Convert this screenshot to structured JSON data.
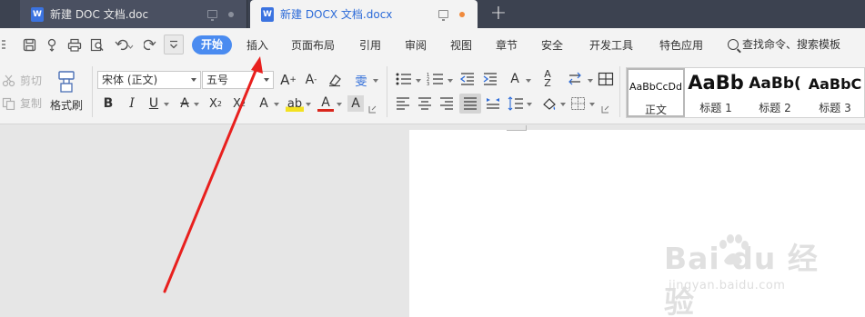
{
  "tabs": [
    {
      "icon": "W",
      "title": "新建 DOC 文档.doc",
      "active": false
    },
    {
      "icon": "W",
      "title": "新建 DOCX 文档.docx",
      "active": true
    }
  ],
  "new_tab_label": "+",
  "menu": {
    "start": "开始",
    "items": [
      "插入",
      "页面布局",
      "引用",
      "审阅",
      "视图",
      "章节",
      "安全",
      "开发工具",
      "特色应用"
    ],
    "search": "查找命令、搜索模板"
  },
  "ribbon": {
    "cut": "剪切",
    "copy": "复制",
    "format_painter": "格式刷",
    "font_name": "宋体 (正文)",
    "font_size": "五号"
  },
  "styles": [
    {
      "sample": "AaBbCcDd",
      "name": "正文"
    },
    {
      "sample": "AaBb",
      "name": "标题 1"
    },
    {
      "sample": "AaBb(",
      "name": "标题 2"
    },
    {
      "sample": "AaBbC",
      "name": "标题 3"
    }
  ],
  "watermark": {
    "brand": "Bai du 经验",
    "url": "jingyan.baidu.com"
  },
  "colors": {
    "accent": "#4a8bf0",
    "tab_active_text": "#2b6ad8",
    "arrow": "#e8201e",
    "unsaved_dot": "#f08a3c"
  }
}
